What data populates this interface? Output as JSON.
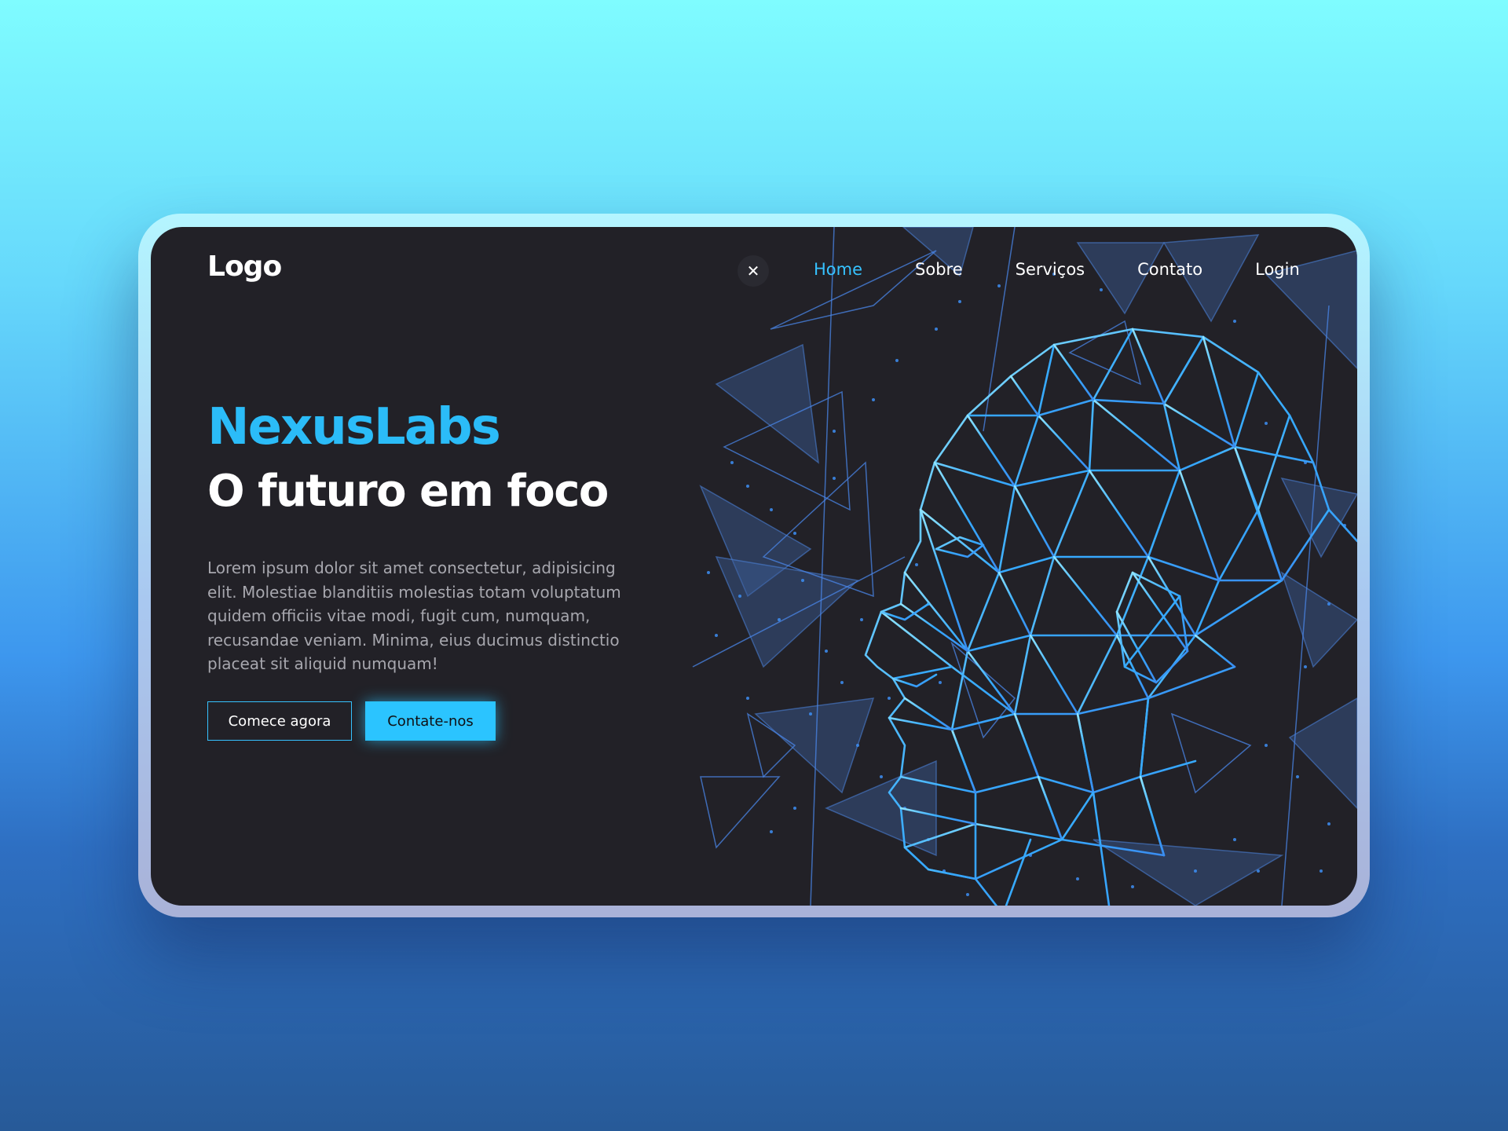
{
  "header": {
    "logo": "Logo",
    "close_symbol": "✕",
    "nav": [
      {
        "label": "Home",
        "active": true
      },
      {
        "label": "Sobre",
        "active": false
      },
      {
        "label": "Serviços",
        "active": false
      },
      {
        "label": "Contato",
        "active": false
      },
      {
        "label": "Login",
        "active": false
      }
    ]
  },
  "hero": {
    "brand": "NexusLabs",
    "headline": "O futuro em foco",
    "description": "Lorem ipsum dolor sit amet consectetur, adipisicing elit. Molestiae blanditiis molestias totam voluptatum quidem officiis vitae modi, fugit cum, numquam, recusandae veniam. Minima, eius ducimus distinctio placeat sit aliquid numquam!",
    "primary_button": "Comece agora",
    "secondary_button": "Contate-nos"
  },
  "colors": {
    "accent": "#2bbcf8",
    "panel_background": "#222127",
    "mesh_line": "#36aaff",
    "triangle_fill": "#3b5d9a"
  },
  "icons": {
    "close": "close-icon",
    "illustration": "wireframe-head-illustration"
  }
}
